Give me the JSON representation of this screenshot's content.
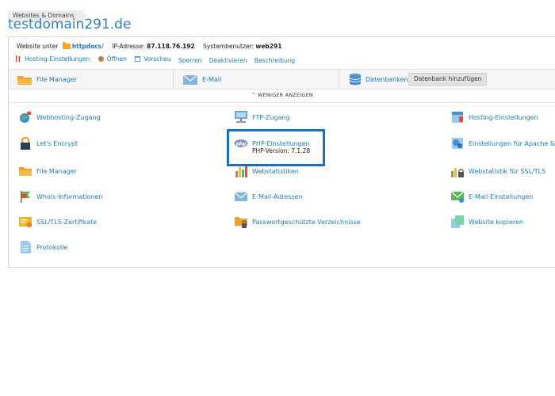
{
  "breadcrumb": "Websites & Domains",
  "page_title": "testdomain291.de",
  "info": {
    "website_label": "Website unter",
    "website_folder": "httpdocs/",
    "ip_label": "IP-Adresse:",
    "ip_value": "87.118.76.192",
    "user_label": "Systembenutzer:",
    "user_value": "web291"
  },
  "actions": [
    "Hosting-Einstellungen",
    "Öffnen",
    "Vorschau",
    "Sperren",
    "Deaktivieren",
    "Beschreibung"
  ],
  "tabs": {
    "file_manager": "File Manager",
    "email": "E-Mail",
    "databases": "Datenbanken",
    "add_database": "Datenbank hinzufügen"
  },
  "toggle_label": "WENIGER ANZEIGEN",
  "services": {
    "col1": [
      "Webhosting-Zugang",
      "Let's Encrypt",
      "File Manager",
      "Whois-Informationen",
      "SSL/TLS-Zertifikate",
      "Protokolle"
    ],
    "col2": [
      "FTP-Zugang",
      "PHP-Einstellungen",
      "Webstatistiken",
      "E-Mail-Adressen",
      "Passwortgeschützte Verzeichnisse"
    ],
    "col3": [
      "Hosting-Einstellungen",
      "Einstellungen für Apache & ng",
      "Webstatistik für SSL/TLS",
      "E-Mail-Einstellungen",
      "Website kopieren"
    ]
  },
  "php_version": "PHP-Version: 7.1.28",
  "php_badge": "php",
  "colors": {
    "link": "#1f7ab8",
    "title": "#2f7fc1",
    "highlight": "#1b6fc4",
    "folder": "#f6a623"
  }
}
